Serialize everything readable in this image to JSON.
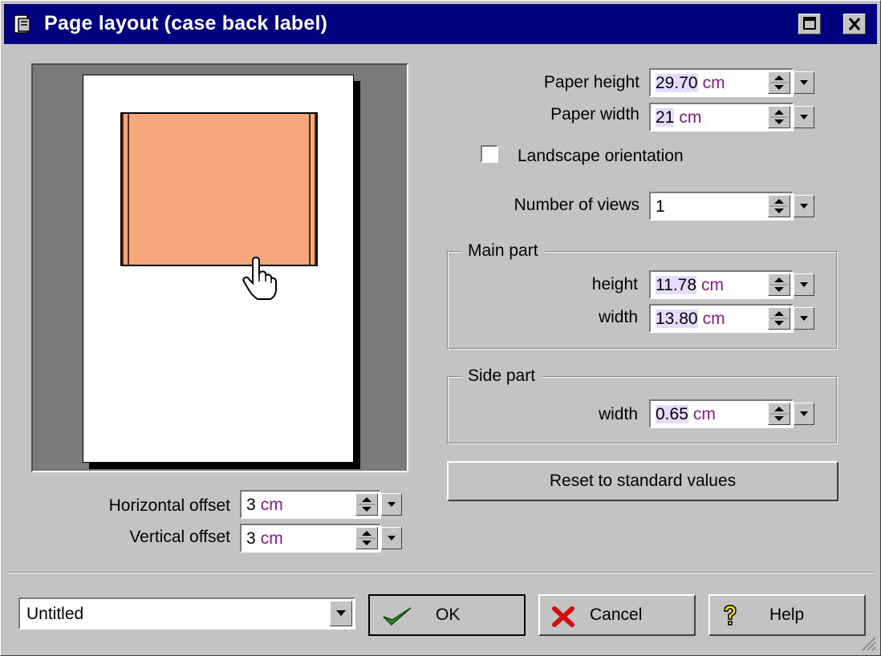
{
  "window": {
    "title": "Page layout (case back label)",
    "colors": {
      "titlebar": "#00007f",
      "label_fill": "#f3a77a",
      "unit_text": "#8b1a8b"
    }
  },
  "paper": {
    "height_label": "Paper height",
    "height_value": "29.70",
    "height_unit": "cm",
    "width_label": "Paper width",
    "width_value": "21",
    "width_unit": "cm",
    "landscape_label": "Landscape orientation",
    "landscape_checked": false
  },
  "views": {
    "label": "Number of views",
    "value": "1"
  },
  "main_part": {
    "title": "Main part",
    "height_label": "height",
    "height_value": "11.78",
    "height_unit": "cm",
    "width_label": "width",
    "width_value": "13.80",
    "width_unit": "cm"
  },
  "side_part": {
    "title": "Side part",
    "width_label": "width",
    "width_value": "0.65",
    "width_unit": "cm"
  },
  "reset_button": "Reset to standard values",
  "offsets": {
    "horizontal_label": "Horizontal offset",
    "horizontal_value": "3",
    "horizontal_unit": "cm",
    "vertical_label": "Vertical offset",
    "vertical_value": "3",
    "vertical_unit": "cm"
  },
  "footer": {
    "template_value": "Untitled",
    "ok_label": "OK",
    "cancel_label": "Cancel",
    "help_label": "Help"
  },
  "icons": [
    "app-icon",
    "minimize-icon",
    "close-icon",
    "hand-cursor-icon",
    "checkmark-icon",
    "x-cancel-icon",
    "question-icon",
    "resize-grip-icon"
  ]
}
